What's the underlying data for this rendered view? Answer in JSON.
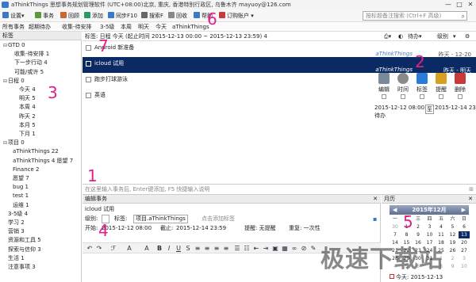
{
  "window": {
    "title": "aThinkThings 思想事务规划管理软件 (UTC+08:00)北京, 重庆, 香港特别行政区, 乌鲁木齐    mayuoy@126.com",
    "min": "—",
    "max": "□",
    "close": "✕"
  },
  "menu": {
    "items": [
      {
        "label": "设置▾",
        "icon": "settings-icon",
        "color": "#3a78c8"
      },
      {
        "label": "事务",
        "icon": "task-icon",
        "color": "#5a9a3a"
      },
      {
        "label": "回顾",
        "icon": "review-icon",
        "color": "#c86a2a"
      },
      {
        "label": "添加",
        "icon": "add-icon",
        "color": "#2a9a6a"
      },
      {
        "label": "同步F10",
        "icon": "sync-icon",
        "color": "#3a78c8"
      },
      {
        "label": "搜索F",
        "icon": "search-icon",
        "color": "#666"
      },
      {
        "label": "回收",
        "icon": "recycle-icon",
        "color": "#888"
      },
      {
        "label": "帮助",
        "icon": "help-icon",
        "color": "#3a78c8"
      },
      {
        "label": "订购账户 ▾",
        "icon": "account-icon",
        "color": "#c83a3a"
      }
    ],
    "search_placeholder": "按标题备注搜索 (Ctrl+F 高级)"
  },
  "tabs": [
    "所有事务",
    "超期待办",
    "收集-待安排",
    "3-5级",
    "本周",
    "明天",
    "今天",
    "aThinkThings"
  ],
  "sidebar": {
    "header": "标签",
    "rows": [
      {
        "toggle": "⊟",
        "label": "GTD 0"
      },
      {
        "toggle": "",
        "label": "收集-待安排 1"
      },
      {
        "toggle": "",
        "label": "下一步行动 4"
      },
      {
        "toggle": "",
        "label": "可能/或许 5"
      },
      {
        "toggle": "⊟",
        "label": "日程 0"
      },
      {
        "toggle": "",
        "label": "今天 4"
      },
      {
        "toggle": "",
        "label": "明天 5"
      },
      {
        "toggle": "",
        "label": "本周 4"
      },
      {
        "toggle": "",
        "label": "昨天 2"
      },
      {
        "toggle": "",
        "label": "本月 5"
      },
      {
        "toggle": "",
        "label": "下月 1"
      },
      {
        "toggle": "⊟",
        "label": "项目 0"
      },
      {
        "toggle": "",
        "label": "aThinkThings 22"
      },
      {
        "toggle": "",
        "label": "aThinkThings 4 愿望 7"
      },
      {
        "toggle": "",
        "label": "Finance 2"
      },
      {
        "toggle": "",
        "label": "愿望 7"
      },
      {
        "toggle": "",
        "label": "bug 1"
      },
      {
        "toggle": "",
        "label": "test 1"
      },
      {
        "toggle": "",
        "label": "运维 1"
      },
      {
        "toggle": "",
        "label": "3-5级 4"
      },
      {
        "toggle": "",
        "label": "学习 2"
      },
      {
        "toggle": "",
        "label": "营销 3"
      },
      {
        "toggle": "",
        "label": "资源和工具 5"
      },
      {
        "toggle": "",
        "label": "探索与信仰 3"
      },
      {
        "toggle": "",
        "label": "生活 1"
      },
      {
        "toggle": "",
        "label": "注意事项 3"
      }
    ]
  },
  "tasklist": {
    "header": "标签: 日程 今天 (起止时间 2015-12-13 00:00 ~ 2015-12-13 23:59) 4",
    "status": "待办",
    "sort": "级别",
    "tasks": [
      {
        "title": "Android 新准备",
        "project": "aThinkThings",
        "due": "昨天 - 12-20",
        "selected": false
      },
      {
        "title": "icloud 试用",
        "project": "aThinkThings",
        "due": "昨天 - 明天",
        "selected": true
      },
      {
        "title": "跑步打球游泳",
        "project": "",
        "due": "",
        "selected": false
      },
      {
        "title": "英语",
        "project": "",
        "due": "",
        "selected": false
      }
    ]
  },
  "props": {
    "items": [
      {
        "label": "编辑",
        "color": "#7a8a9a"
      },
      {
        "label": "时间",
        "color": "#8a8a8a"
      },
      {
        "label": "标签",
        "color": "#2a7ad8"
      },
      {
        "label": "提醒",
        "color": "#d8a020"
      },
      {
        "label": "删除",
        "color": "#c83a3a"
      }
    ],
    "start": "2015-12-12 08:00",
    "to": "至",
    "end": "2015-12-14 23:59",
    "status": "待办"
  },
  "quickadd": {
    "placeholder": "在这里输入事务后, Enter键添加, F5 快捷输入说明"
  },
  "editor": {
    "header": "编辑事务",
    "title": "icloud 试用",
    "level_label": "级别:",
    "tag_label": "标签:",
    "tag_value": "项目.aThinkThings",
    "tag_hint": "点击添加标签",
    "start_label": "开始:",
    "start_value": "2015-12-12 08:00",
    "end_label": "截止:",
    "end_value": "2015-12-14 23:59",
    "remind_label": "提醒: 无提醒",
    "repeat_label": "重复: 一次性"
  },
  "calendar": {
    "header": "月历",
    "month": "2015年12月",
    "weekdays": [
      "一",
      "二",
      "三",
      "四",
      "五",
      "六",
      "日"
    ],
    "weeks": [
      [
        "30",
        "1",
        "2",
        "3",
        "4",
        "5",
        "6"
      ],
      [
        "7",
        "8",
        "9",
        "10",
        "11",
        "12",
        "13"
      ],
      [
        "14",
        "15",
        "16",
        "17",
        "18",
        "19",
        "20"
      ],
      [
        "21",
        "22",
        "23",
        "24",
        "25",
        "26",
        "27"
      ],
      [
        "28",
        "29",
        "30",
        "31",
        "1",
        "2",
        "3"
      ],
      [
        "4",
        "5",
        "6",
        "7",
        "8",
        "9",
        "10"
      ]
    ],
    "today": "今天: 2015-12-13"
  },
  "markers": [
    "1",
    "2",
    "3",
    "4",
    "5",
    "6",
    "7"
  ],
  "watermark": "极速下载站"
}
